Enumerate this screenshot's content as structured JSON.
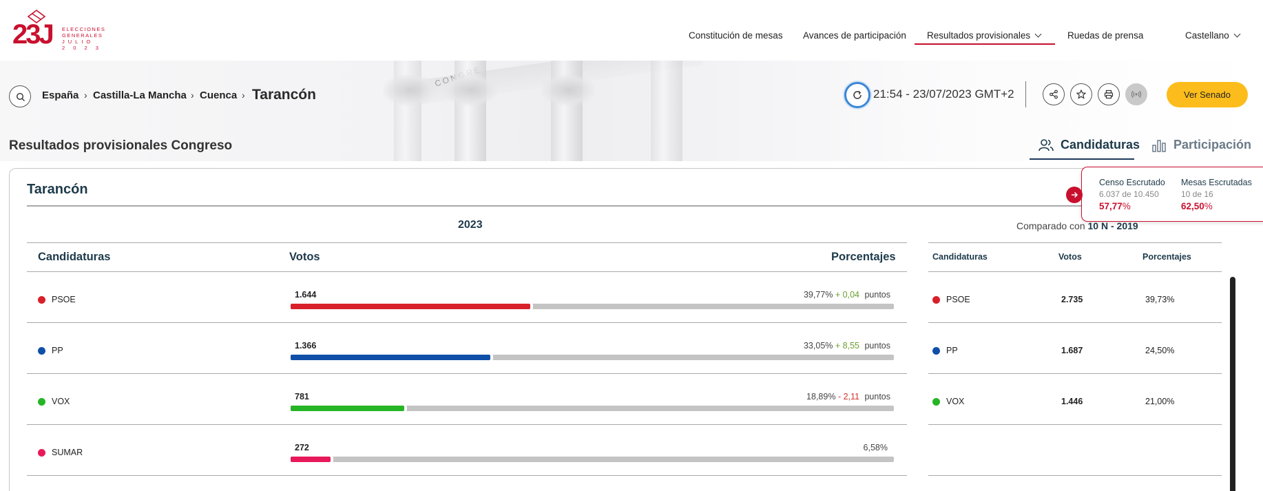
{
  "logo": {
    "mark": "23J",
    "line1": "ELECCIONES",
    "line2": "GENERALES",
    "line3": "JULIO",
    "line4": "2 0 2 3"
  },
  "nav": {
    "items": [
      {
        "label": "Constitución de mesas"
      },
      {
        "label": "Avances de participación"
      },
      {
        "label": "Resultados provisionales"
      },
      {
        "label": "Ruedas de prensa"
      }
    ],
    "language": "Castellano"
  },
  "breadcrumb": {
    "items": [
      "España",
      "Castilla-La Mancha",
      "Cuenca"
    ],
    "current": "Tarancón"
  },
  "timestamp": "21:54 - 23/07/2023 GMT+2",
  "senado_button": "Ver Senado",
  "page_title": "Resultados provisionales Congreso",
  "tabs": [
    "Candidaturas",
    "Participación"
  ],
  "card_title": "Tarancón",
  "year": "2023",
  "headers": {
    "candidaturas": "Candidaturas",
    "votos": "Votos",
    "porcentajes": "Porcentajes"
  },
  "comparison": {
    "prefix": "Comparado con",
    "election": "10 N - 2019"
  },
  "scrutiny": {
    "censo_title": "Censo Escrutado",
    "censo_detail": "6.037 de 10.450",
    "censo_pct": "57,77",
    "mesas_title": "Mesas Escrutadas",
    "mesas_detail": "10 de 16",
    "mesas_pct": "62,50",
    "pct_sign": "%"
  },
  "results": [
    {
      "party": "PSOE",
      "color": "#d8202a",
      "votes": "1.644",
      "pct": "39,77%",
      "diff": "+ 0,04",
      "diff_sign": "pos",
      "pts": "puntos",
      "share": 39.77
    },
    {
      "party": "PP",
      "color": "#0f4fa8",
      "votes": "1.366",
      "pct": "33,05%",
      "diff": "+ 8,55",
      "diff_sign": "pos",
      "pts": "puntos",
      "share": 33.05
    },
    {
      "party": "VOX",
      "color": "#25b525",
      "votes": "781",
      "pct": "18,89%",
      "diff": "- 2,11",
      "diff_sign": "neg",
      "pts": "puntos",
      "share": 18.89
    },
    {
      "party": "SUMAR",
      "color": "#e8195a",
      "votes": "272",
      "pct": "6,58%",
      "diff": "",
      "diff_sign": "",
      "pts": "",
      "share": 6.58
    }
  ],
  "previous": [
    {
      "party": "PSOE",
      "color": "#d8202a",
      "votes": "2.735",
      "pct": "39,73%"
    },
    {
      "party": "PP",
      "color": "#0f4fa8",
      "votes": "1.687",
      "pct": "24,50%"
    },
    {
      "party": "VOX",
      "color": "#25b525",
      "votes": "1.446",
      "pct": "21,00%"
    }
  ],
  "colors": {
    "brand": "#c8102e",
    "accent_button": "#fcbd1c",
    "track": "#c4c4c4"
  }
}
